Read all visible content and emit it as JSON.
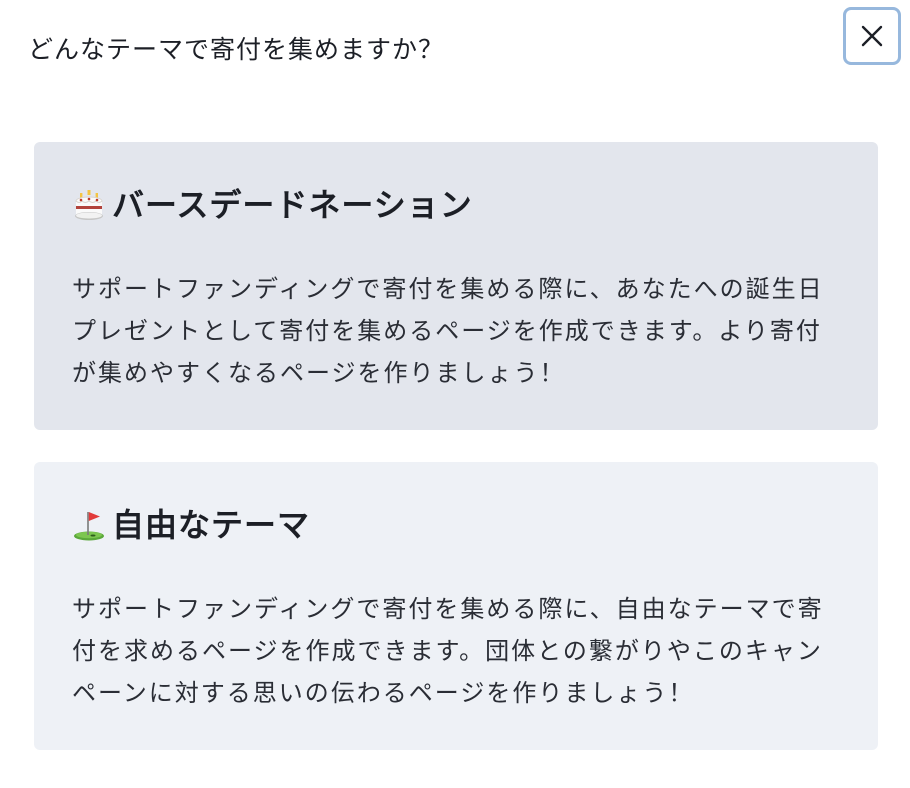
{
  "modal": {
    "title": "どんなテーマで寄付を集めますか？",
    "close_icon": "close-icon"
  },
  "cards": [
    {
      "icon": "birthday-cake-icon",
      "title": "バースデードネーション",
      "description": "サポートファンディングで寄付を集める際に、あなたへの誕生日プレゼントとして寄付を集めるページを作成できます。より寄付が集めやすくなるページを作りましょう！"
    },
    {
      "icon": "golf-flag-icon",
      "title": "自由なテーマ",
      "description": "サポートファンディングで寄付を集める際に、自由なテーマで寄付を求めるページを作成できます。団体との繋がりやこのキャンペーンに対する思いの伝わるページを作りましょう！"
    }
  ],
  "colors": {
    "card_selected_bg": "#e3e6ed",
    "card_bg": "#eef1f6",
    "focus_ring": "#97b8dd"
  }
}
